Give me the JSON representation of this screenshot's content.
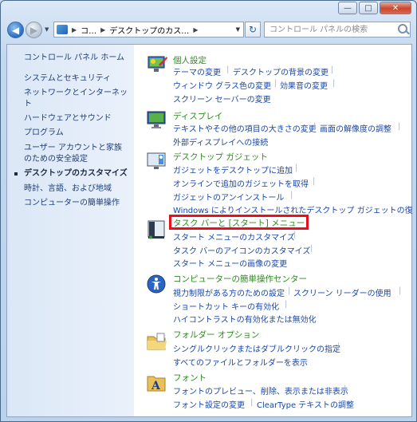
{
  "window": {
    "minimize": "—",
    "maximize": "□",
    "close": "✕"
  },
  "address": {
    "seg1": "コ…",
    "seg2": "デスクトップのカス…",
    "search_placeholder": "コントロール パネルの検索"
  },
  "sidebar": {
    "home": "コントロール パネル ホーム",
    "items": [
      "システムとセキュリティ",
      "ネットワークとインターネット",
      "ハードウェアとサウンド",
      "プログラム",
      "ユーザー アカウントと家族のための安全設定",
      "デスクトップのカスタマイズ",
      "時計、言語、および地域",
      "コンピューターの簡単操作"
    ]
  },
  "categories": {
    "personalize": {
      "title": "個人設定",
      "links": [
        "テーマの変更",
        "デスクトップの背景の変更",
        "ウィンドウ グラス色の変更",
        "効果音の変更",
        "スクリーン セーバーの変更"
      ]
    },
    "display": {
      "title": "ディスプレイ",
      "links": [
        "テキストやその他の項目の大きさの変更",
        "画面の解像度の調整",
        "外部ディスプレイへの接続"
      ]
    },
    "gadgets": {
      "title": "デスクトップ ガジェット",
      "links": [
        "ガジェットをデスクトップに追加",
        "オンラインで追加のガジェットを取得",
        "ガジェットのアンインストール",
        "Windows によりインストールされたデスクトップ ガジェットの復"
      ]
    },
    "taskbar": {
      "title": "タスク バーと [スタート] メニュー",
      "links": [
        "スタート メニューのカスタマイズ",
        "タスク バーのアイコンのカスタマイズ",
        "スタート メニューの画像の変更"
      ]
    },
    "ease": {
      "title": "コンピューターの簡単操作センター",
      "links": [
        "視力制限がある方のための設定",
        "スクリーン リーダーの使用",
        "ショートカット キーの有効化",
        "ハイコントラストの有効化または無効化"
      ]
    },
    "folder": {
      "title": "フォルダー オプション",
      "links": [
        "シングルクリックまたはダブルクリックの指定",
        "すべてのファイルとフォルダーを表示"
      ]
    },
    "fonts": {
      "title": "フォント",
      "links": [
        "フォントのプレビュー、削除、表示または非表示",
        "フォント設定の変更",
        "ClearType テキストの調整"
      ]
    }
  },
  "colors": {
    "category_title": "#2e8b1f",
    "link": "#1a47a8",
    "highlight_box": "#e8101c"
  }
}
